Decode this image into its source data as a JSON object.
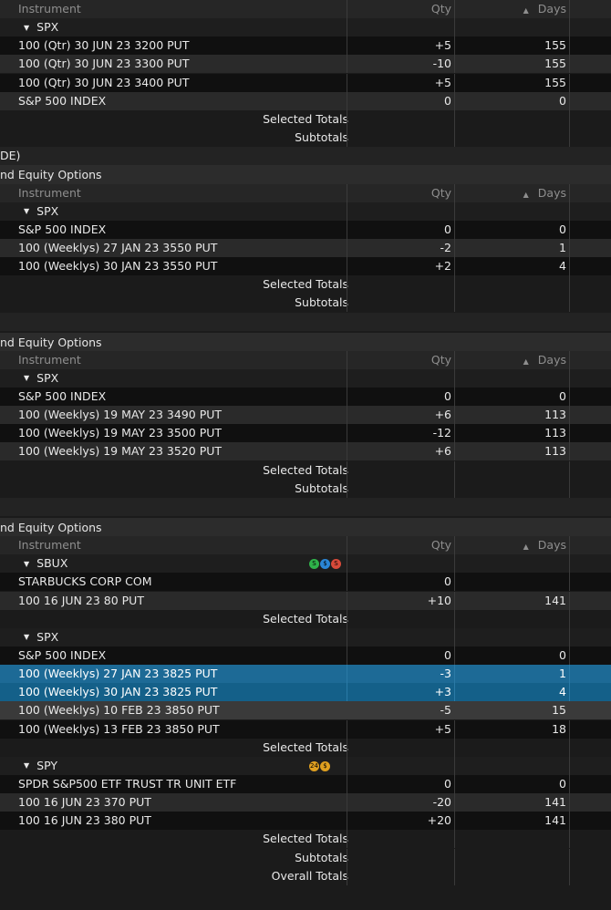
{
  "columns": {
    "instrument": "Instrument",
    "qty": "Qty",
    "days": "Days"
  },
  "sections": [
    {
      "header": "",
      "symbols": [
        {
          "name": "SPX",
          "rows": [
            {
              "inst": "100 (Qtr) 30 JUN 23 3200 PUT",
              "qty": "+5",
              "days": "155"
            },
            {
              "inst": "100 (Qtr) 30 JUN 23 3300 PUT",
              "qty": "-10",
              "days": "155"
            },
            {
              "inst": "100 (Qtr) 30 JUN 23 3400 PUT",
              "qty": "+5",
              "days": "155"
            },
            {
              "inst": "S&P 500 INDEX",
              "qty": "0",
              "days": "0"
            }
          ]
        }
      ]
    },
    {
      "header": "nd Equity Options",
      "symbols": [
        {
          "name": "SPX",
          "rows": [
            {
              "inst": "S&P 500 INDEX",
              "qty": "0",
              "days": "0"
            },
            {
              "inst": "100 (Weeklys) 27 JAN 23 3550 PUT",
              "qty": "-2",
              "days": "1"
            },
            {
              "inst": "100 (Weeklys) 30 JAN 23 3550 PUT",
              "qty": "+2",
              "days": "4"
            }
          ]
        }
      ]
    },
    {
      "header": "nd Equity Options",
      "symbols": [
        {
          "name": "SPX",
          "rows": [
            {
              "inst": "S&P 500 INDEX",
              "qty": "0",
              "days": "0"
            },
            {
              "inst": "100 (Weeklys) 19 MAY 23 3490 PUT",
              "qty": "+6",
              "days": "113"
            },
            {
              "inst": "100 (Weeklys) 19 MAY 23 3500 PUT",
              "qty": "-12",
              "days": "113"
            },
            {
              "inst": "100 (Weeklys) 19 MAY 23 3520 PUT",
              "qty": "+6",
              "days": "113"
            }
          ]
        }
      ]
    },
    {
      "header": "nd Equity Options",
      "symbols": [
        {
          "name": "SBUX",
          "rows": [
            {
              "inst": "STARBUCKS CORP COM",
              "qty": "0",
              "days": ""
            },
            {
              "inst": "100 16 JUN 23 80 PUT",
              "qty": "+10",
              "days": "141"
            }
          ]
        },
        {
          "name": "SPX",
          "rows": [
            {
              "inst": "S&P 500 INDEX",
              "qty": "0",
              "days": "0"
            },
            {
              "inst": "100 (Weeklys) 27 JAN 23 3825 PUT",
              "qty": "-3",
              "days": "1"
            },
            {
              "inst": "100 (Weeklys) 30 JAN 23 3825 PUT",
              "qty": "+3",
              "days": "4"
            },
            {
              "inst": "100 (Weeklys) 10 FEB 23 3850 PUT",
              "qty": "-5",
              "days": "15"
            },
            {
              "inst": "100 (Weeklys) 13 FEB 23 3850 PUT",
              "qty": "+5",
              "days": "18"
            }
          ]
        },
        {
          "name": "SPY",
          "rows": [
            {
              "inst": "SPDR S&P500 ETF TRUST TR UNIT ETF",
              "qty": "0",
              "days": "0"
            },
            {
              "inst": "100 16 JUN 23 370 PUT",
              "qty": "-20",
              "days": "141"
            },
            {
              "inst": "100 16 JUN 23 380 PUT",
              "qty": "+20",
              "days": "141"
            }
          ]
        }
      ]
    }
  ],
  "labels": {
    "selected_totals": "Selected Totals",
    "subtotals": "Subtotals",
    "overall_totals": "Overall Totals",
    "de_fragment": "DE)"
  },
  "badges": {
    "sbux": [
      "S",
      "$",
      "S"
    ],
    "spy": [
      "24",
      "$"
    ]
  },
  "colors": {
    "selected": "#1d6a96",
    "badge_green": "#2fb34a",
    "badge_blue": "#2a86d6",
    "badge_red": "#d84a3a",
    "badge_orange": "#e0a020"
  }
}
